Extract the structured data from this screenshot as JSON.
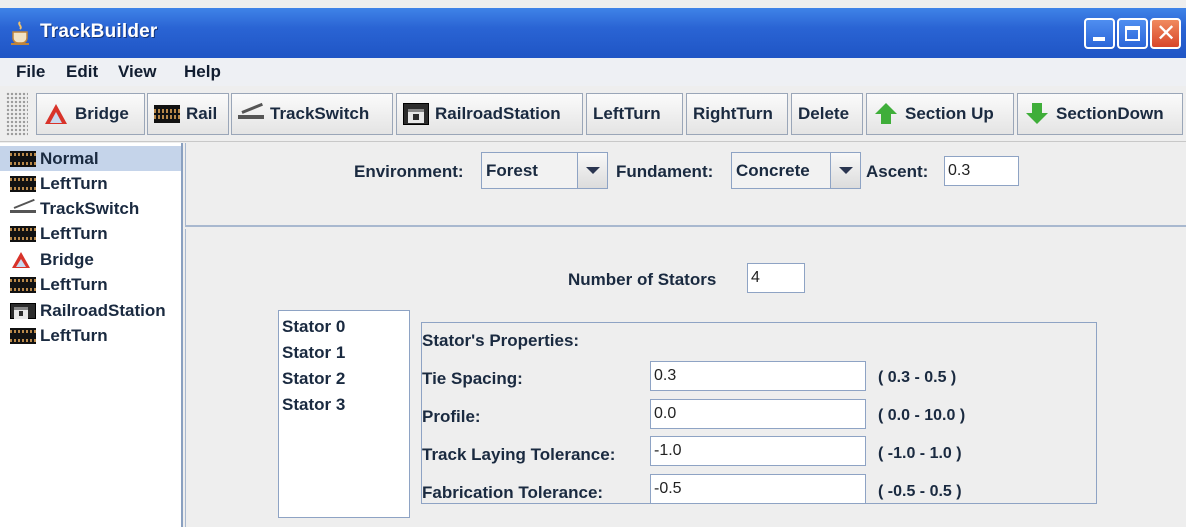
{
  "window": {
    "title": "TrackBuilder"
  },
  "menu": [
    "File",
    "Edit",
    "View",
    "Help"
  ],
  "toolbar": {
    "bridge": "Bridge",
    "rail": "Rail",
    "trackswitch": "TrackSwitch",
    "station": "RailroadStation",
    "leftturn": "LeftTurn",
    "rightturn": "RightTurn",
    "delete": "Delete",
    "section_up": "Section Up",
    "section_down": "SectionDown"
  },
  "track_list": [
    {
      "label": "Normal",
      "icon": "rail-icon",
      "selected": true
    },
    {
      "label": "LeftTurn",
      "icon": "rail-icon"
    },
    {
      "label": "TrackSwitch",
      "icon": "trackswitch-icon"
    },
    {
      "label": "LeftTurn",
      "icon": "rail-icon"
    },
    {
      "label": "Bridge",
      "icon": "bridge-icon"
    },
    {
      "label": "LeftTurn",
      "icon": "rail-icon"
    },
    {
      "label": "RailroadStation",
      "icon": "railroad-station-icon"
    },
    {
      "label": "LeftTurn",
      "icon": "rail-icon"
    }
  ],
  "environment": {
    "env_label": "Environment:",
    "env_value": "Forest",
    "fund_label": "Fundament:",
    "fund_value": "Concrete",
    "ascent_label": "Ascent:",
    "ascent_value": "0.3"
  },
  "stators": {
    "count_label": "Number of Stators",
    "count_value": "4",
    "items": [
      "Stator 0",
      "Stator 1",
      "Stator 2",
      "Stator 3"
    ],
    "props_title": "Stator's Properties:",
    "props": [
      {
        "label": "Tie Spacing:",
        "value": "0.3",
        "range": "( 0.3 - 0.5 )"
      },
      {
        "label": "Profile:",
        "value": "0.0",
        "range": "( 0.0 - 10.0 )"
      },
      {
        "label": "Track Laying Tolerance:",
        "value": "-1.0",
        "range": "( -1.0 - 1.0 )"
      },
      {
        "label": "Fabrication Tolerance:",
        "value": "-0.5",
        "range": "( -0.5 - 0.5 )"
      }
    ]
  },
  "colors": {
    "titlebar": "#2a64d4",
    "selection": "#c5d4ea",
    "bridge_red": "#d8332a",
    "arrow_green": "#3fae3a"
  }
}
